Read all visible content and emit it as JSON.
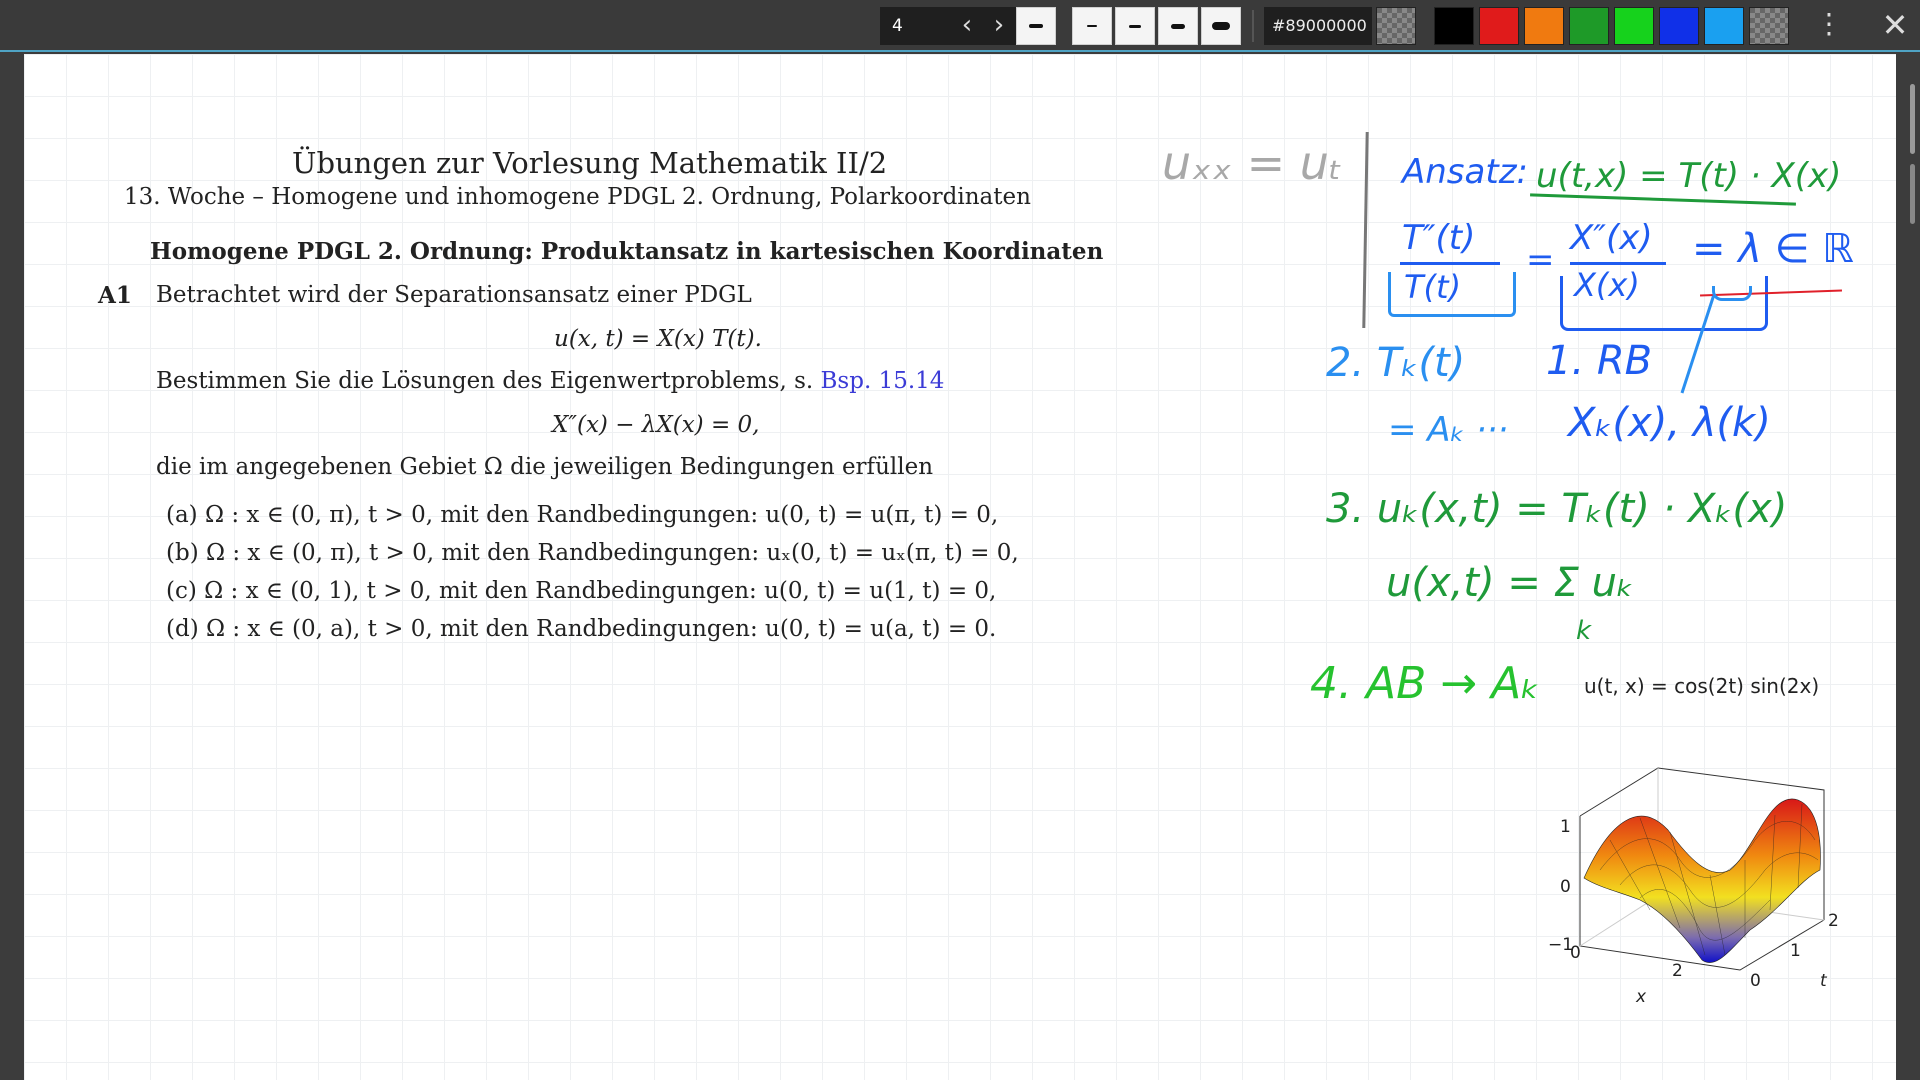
{
  "toolbar": {
    "page_number": "4",
    "prev_label": "‹",
    "next_label": "›",
    "color_hex": "#89000000",
    "swatches": [
      "#000000",
      "#e01b1b",
      "#f07a10",
      "#1e9a28",
      "#16d21c",
      "#1030e8",
      "#1aa0f0"
    ]
  },
  "doc": {
    "title": "Übungen zur Vorlesung Mathematik II/2",
    "subtitle": "13. Woche – Homogene und inhomogene PDGL 2. Ordnung, Polarkoordinaten",
    "section": "Homogene PDGL 2. Ordnung: Produktansatz in kartesischen Koordinaten",
    "label": "A1",
    "intro": "Betrachtet wird der Separationsansatz einer PDGL",
    "ansatz_eq": "u(x, t) = X(x) T(t).",
    "task_text": "Bestimmen Sie die Lösungen des Eigenwertproblems, s.",
    "task_link": "Bsp. 15.14",
    "ev_eq": "X″(x) − λX(x) = 0,",
    "cond_text": "die im angegebenen Gebiet Ω die jeweiligen Bedingungen erfüllen",
    "cases": [
      "(a)  Ω :  x ∈ (0, π),  t > 0,  mit den Randbedingungen:  u(0, t) = u(π, t) = 0,",
      "(b)  Ω :  x ∈ (0, π),  t > 0,  mit den Randbedingungen:  uₓ(0, t) = uₓ(π, t) = 0,",
      "(c)  Ω :  x ∈ (0, 1),  t > 0,  mit den Randbedingungen:  u(0, t) = u(1, t) = 0,",
      "(d)  Ω :  x ∈ (0, a),  t > 0,  mit den Randbedingungen:  u(0, t) = u(a, t) = 0."
    ]
  },
  "notes": {
    "gray_eq": "uₓₓ = uₜ",
    "ansatz_label": "Ansatz:",
    "ansatz_formula": "u(t,x) = T(t) · X(x)",
    "frac_left_num": "T″(t)",
    "frac_left_den": "T(t)",
    "frac_right_num": "X″(x)",
    "frac_right_den": "X(x)",
    "eq1": "=",
    "eq2": "= λ ∈ ℝ",
    "step1": "1. RB",
    "step1_result": "Xₖ(x), λ(k)",
    "step2": "2. Tₖ(t)",
    "step2_result": "= Aₖ ···",
    "step3": "3. uₖ(x,t) = Tₖ(t) · Xₖ(x)",
    "step3_sum": "u(x,t) = Σ uₖ",
    "step3_sum_index": "k",
    "step4": "4. AB → Aₖ",
    "plot_formula": "u(t, x) = cos(2t) sin(2x)"
  },
  "plot": {
    "z_ticks": [
      "1",
      "0",
      "−1"
    ],
    "x_ticks": [
      "0",
      "2"
    ],
    "t_ticks": [
      "0",
      "1",
      "2"
    ],
    "x_label": "x",
    "t_label": "t"
  }
}
